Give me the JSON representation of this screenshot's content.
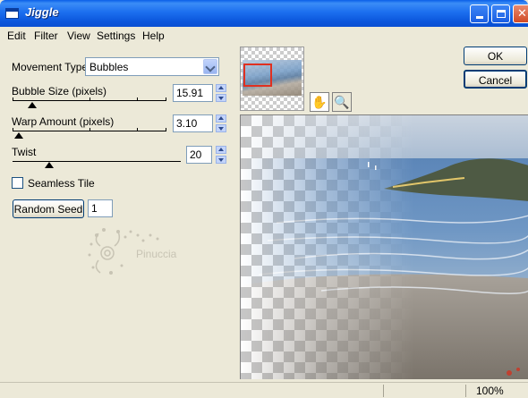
{
  "window": {
    "title": "Jiggle",
    "minimize_label": "",
    "maximize_label": "",
    "close_label": "✕"
  },
  "menu": [
    "Edit",
    "Filter",
    "View",
    "Settings",
    "Help"
  ],
  "controls": {
    "movement_type_label": "Movement Type:",
    "movement_type_value": "Bubbles",
    "bubble_size_label": "Bubble Size (pixels)",
    "bubble_size_value": "15.91",
    "warp_amount_label": "Warp Amount (pixels)",
    "warp_amount_value": "3.10",
    "twist_label": "Twist",
    "twist_value": "20",
    "seamless_tile_label": "Seamless Tile",
    "seamless_tile_checked": false,
    "random_seed_button": "Random Seed",
    "random_seed_value": "1"
  },
  "watermark": "Pinuccia",
  "buttons": {
    "ok": "OK",
    "cancel": "Cancel"
  },
  "status": {
    "zoom": "100%"
  },
  "icons": {
    "hand": "hand-pan-icon",
    "zoom": "magnifier-icon"
  }
}
